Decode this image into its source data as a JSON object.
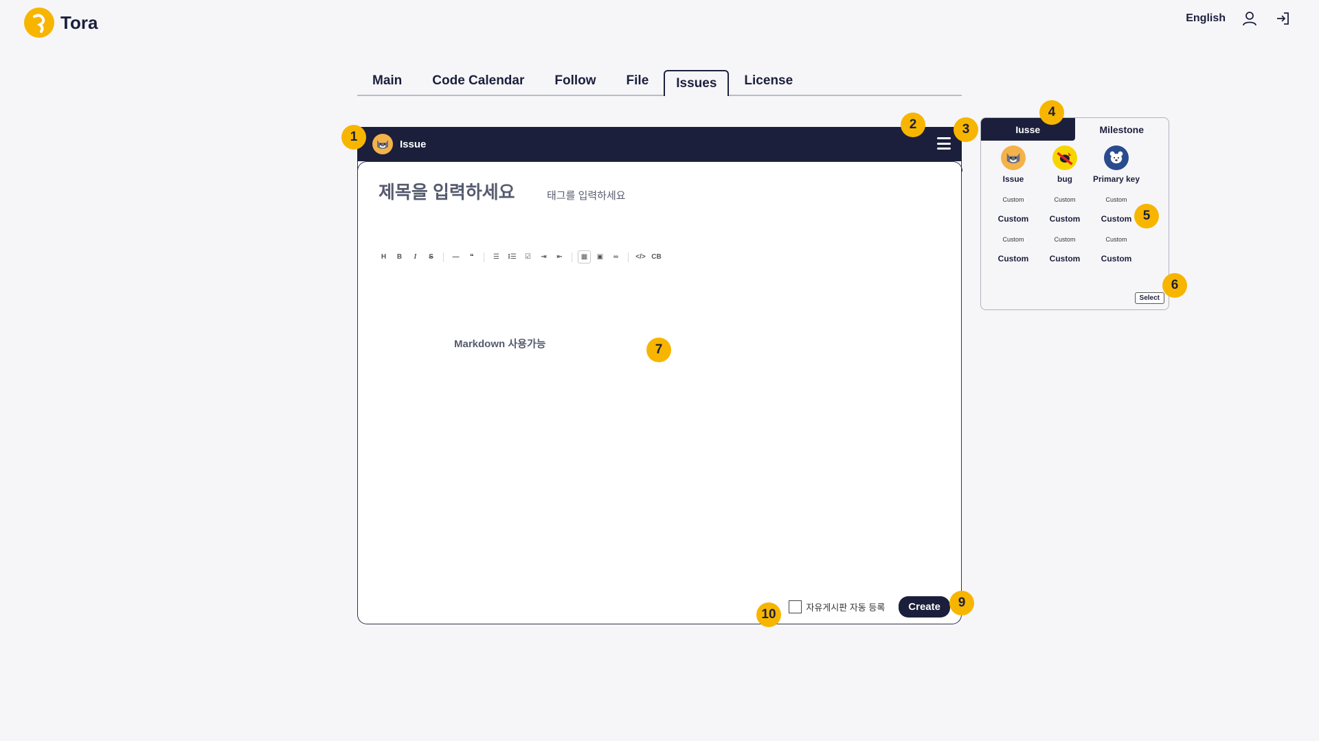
{
  "app": {
    "name": "Tora",
    "language": "English"
  },
  "nav": {
    "tabs": [
      {
        "label": "Main"
      },
      {
        "label": "Code Calendar"
      },
      {
        "label": "Follow"
      },
      {
        "label": "File"
      },
      {
        "label": "Issues"
      },
      {
        "label": "License"
      }
    ],
    "active": "Issues"
  },
  "editor": {
    "header_title": "Issue",
    "title_placeholder": "제목을 입력하세요",
    "tag_placeholder": "태그를 입력하세요",
    "toolbar": [
      "H",
      "B",
      "I",
      "S",
      "hr",
      "quote",
      "ul",
      "ol",
      "task",
      "indent",
      "outdent",
      "table",
      "image",
      "link",
      "code",
      "codeblock"
    ],
    "markdown_hint": "Markdown 사용가능",
    "auto_register_label": "자유게시판 자동 등록",
    "create_label": "Create"
  },
  "labels_panel": {
    "tabs": [
      {
        "label": "Iusse"
      },
      {
        "label": "Milestone"
      }
    ],
    "items": [
      {
        "label": "Issue",
        "icon": "cat-avatar-icon"
      },
      {
        "label": "bug",
        "icon": "bug-icon"
      },
      {
        "label": "Primary key",
        "icon": "bear-icon"
      },
      {
        "label": "Custom",
        "icon_text": "Custom"
      },
      {
        "label": "Custom",
        "icon_text": "Custom"
      },
      {
        "label": "Custom",
        "icon_text": "Custom"
      },
      {
        "label": "Custom",
        "icon_text": "Custom"
      },
      {
        "label": "Custom",
        "icon_text": "Custom"
      },
      {
        "label": "Custom",
        "icon_text": "Custom"
      }
    ],
    "select_label": "Select"
  },
  "markers": [
    "1",
    "2",
    "3",
    "4",
    "5",
    "6",
    "7",
    "9",
    "10"
  ],
  "colors": {
    "navy": "#1b1f3b",
    "accent": "#f7b500",
    "background": "#f6f6f9"
  }
}
